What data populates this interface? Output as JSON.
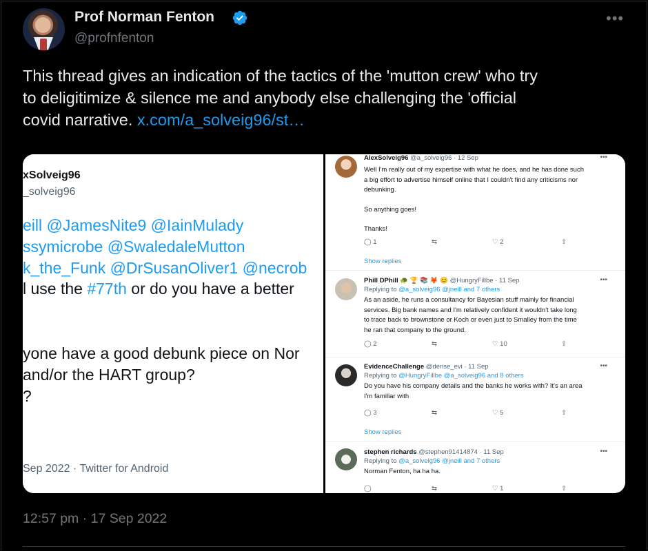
{
  "author": {
    "name": "Prof Norman Fenton",
    "handle": "@profnfenton"
  },
  "tweet": {
    "line1": "This thread gives an indication of the tactics of the 'mutton crew' who try",
    "line2": "to deligitimize & silence me and anybody else challenging the 'official",
    "line3_prefix": "covid narrative. ",
    "link": "x.com/a_solveig96/st…",
    "timestamp": "12:57 pm · 17 Sep 2022"
  },
  "left_panel": {
    "name": "xSolveig96",
    "handle": "_solveig96",
    "mentions1": "eill @JamesNite9 @IainMulady",
    "mentions2": "ssymicrobe @SwaledaleMutton",
    "mentions3": "k_the_Funk @DrSusanOliver1 @necrob",
    "line4_pre": "l use the ",
    "line4_tag": "#77th",
    "line4_post": " or do you have a better",
    "q1": "yone have a good debunk piece on Nor",
    "q2": "and/or the HART group?",
    "q3": "?",
    "date": "Sep 2022 · Twitter for Android"
  },
  "replies": [
    {
      "name": "AlexSolveig96",
      "meta": "@a_solveig96 · 12 Sep",
      "body": [
        "Well I'm really out of my expertise with what he does, and he has done such",
        "a big effort to advertise himself online that I couldn't find any criticisms nor",
        "debunking.",
        "",
        "So anything goes!",
        "",
        "Thanks!"
      ],
      "reply_count": "1",
      "like_count": "2",
      "show_replies": "Show replies"
    },
    {
      "name": "Phill DPhill",
      "meta": "@HungryFillbe · 11 Sep",
      "replying_prefix": "Replying to ",
      "replying_to": "@a_solveig96 @jneill",
      "replying_others": "and 7 others",
      "body": [
        "As an aside, he runs a consultancy for Bayesian stuff mainly for financial",
        "services. Big bank names and I'm relatively confident it wouldn't take long",
        "to trace back to brownstone or Koch or even just to Smalley from the time",
        "he ran that company to the ground."
      ],
      "reply_count": "2",
      "like_count": "10"
    },
    {
      "name": "EvidenceChallenge",
      "meta": "@dense_evi · 11 Sep",
      "replying_prefix": "Replying to ",
      "replying_to": "@HungryFillbe @a_solveig96",
      "replying_others": "and 8 others",
      "body": [
        "Do you have his company details and the banks he works with? It's an area",
        "I'm familiar with"
      ],
      "reply_count": "3",
      "like_count": "5",
      "show_replies": "Show replies"
    },
    {
      "name": "stephen richards",
      "meta": "@stephen91414874 · 11 Sep",
      "replying_prefix": "Replying to ",
      "replying_to": "@a_solveig96 @jneill",
      "replying_others": "and 7 others",
      "body": [
        "Norman Fenton, ha ha ha."
      ],
      "like_count": "1"
    }
  ],
  "colors": {
    "background": "#000000",
    "accent": "#1d9bf0",
    "muted": "#71767b"
  }
}
